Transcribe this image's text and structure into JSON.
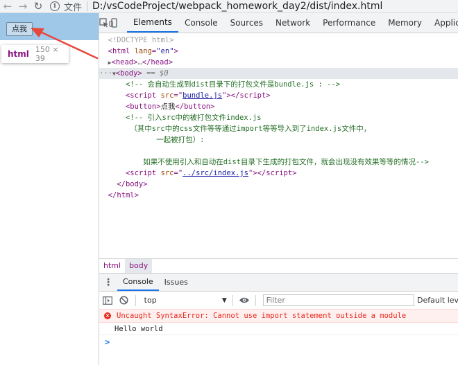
{
  "browser": {
    "back_icon": "arrow-left-icon",
    "forward_icon": "arrow-right-icon",
    "reload_icon": "reload-icon",
    "info_icon": "info-icon",
    "address_label": "文件",
    "address_url": "D:/vsCodeProject/webpack_homework_day2/dist/index.html"
  },
  "page": {
    "button_label": "点我",
    "tooltip_tag": "html",
    "tooltip_size": "150 × 39",
    "highlight_color": "#9ec7e8",
    "annotation_arrow_color": "#e8473b"
  },
  "devtools": {
    "tabs": [
      "Elements",
      "Console",
      "Sources",
      "Network",
      "Performance",
      "Memory",
      "Applica"
    ],
    "active_tab": "Elements",
    "accent_color": "#1a73e8",
    "elements": {
      "doctype": "<!DOCTYPE html>",
      "html_open_tag": "html",
      "html_lang_attr": "lang",
      "html_lang_val": "\"en\"",
      "head_collapsed": "head",
      "head_dots": "…",
      "body_tag": "body",
      "body_suffix": " == $0",
      "comment1": "<!-- 会自动生成到dist目录下的打包文件是bundle.js : -->",
      "script_tag": "script",
      "src_attr": "src",
      "script1_src": "bundle.js",
      "button_tag": "button",
      "button_text": "点我",
      "comment2_line1": "<!-- 引入src中的被打包文件index.js",
      "comment2_line2": "（其中src中的css文件等等通过import等等导入到了index.js文件中，",
      "comment2_line3": "一起被打包）:",
      "comment2_line4": "如果不使用引入和自动在dist目录下生成的打包文件，就会出现没有效果等等的情况-->",
      "script2_src": "../src/index.js",
      "body_close": "body",
      "html_close": "html"
    },
    "breadcrumb": [
      "html",
      "body"
    ],
    "drawer": {
      "tabs": [
        "Console",
        "Issues"
      ],
      "active_tab": "Console",
      "context": "top",
      "filter_placeholder": "Filter",
      "levels_label": "Default lev"
    },
    "console": {
      "error_message": "Uncaught SyntaxError: Cannot use import statement outside a module",
      "log_message": "Hello world",
      "error_color": "#e8281c",
      "prompt": ">"
    }
  }
}
